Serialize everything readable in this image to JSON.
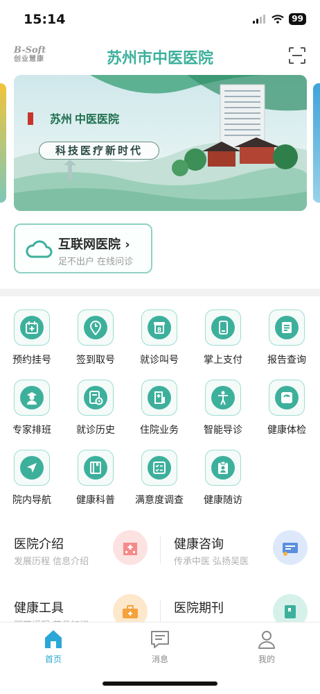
{
  "status_bar": {
    "time": "15:14",
    "battery": "99"
  },
  "header": {
    "logo_top": "B-Soft",
    "logo_bottom": "创业慧康",
    "title": "苏州市中医医院"
  },
  "banner": {
    "brand_big": "苏州",
    "brand_small": "中医医院",
    "slogan": "科技医疗新时代"
  },
  "internet_hospital": {
    "title": "互联网医院 ›",
    "subtitle": "足不出户 在线问诊"
  },
  "grid": [
    {
      "label": "预约挂号",
      "icon": "calendar-add-icon"
    },
    {
      "label": "签到取号",
      "icon": "location-clock-icon"
    },
    {
      "label": "就诊叫号",
      "icon": "queue-ticket-icon"
    },
    {
      "label": "掌上支付",
      "icon": "phone-pay-icon"
    },
    {
      "label": "报告查询",
      "icon": "report-icon"
    },
    {
      "label": "专家排班",
      "icon": "doctor-icon"
    },
    {
      "label": "就诊历史",
      "icon": "history-icon"
    },
    {
      "label": "住院业务",
      "icon": "hospital-bed-icon"
    },
    {
      "label": "智能导诊",
      "icon": "body-guide-icon"
    },
    {
      "label": "健康体检",
      "icon": "scale-icon"
    },
    {
      "label": "院内导航",
      "icon": "navigation-icon"
    },
    {
      "label": "健康科普",
      "icon": "book-icon"
    },
    {
      "label": "满意度调查",
      "icon": "checklist-icon"
    },
    {
      "label": "健康随访",
      "icon": "clipboard-user-icon"
    }
  ],
  "info_cards": [
    {
      "title": "医院介绍",
      "subtitle": "发展历程 信息介绍",
      "icon": "hospital-building-icon",
      "color": "#f58a8a"
    },
    {
      "title": "健康咨询",
      "subtitle": "传承中医 弘扬吴医",
      "icon": "consult-card-icon",
      "color": "#5a8fe0"
    },
    {
      "title": "健康工具",
      "subtitle": "服药提醒 药品知识",
      "icon": "toolbox-icon",
      "color": "#f5a23c"
    },
    {
      "title": "医院期刊",
      "subtitle": "",
      "icon": "journal-icon",
      "color": "#3db09c"
    }
  ],
  "tabbar": [
    {
      "label": "首页",
      "icon": "home-icon",
      "active": true
    },
    {
      "label": "消息",
      "icon": "message-icon",
      "active": false
    },
    {
      "label": "我的",
      "icon": "user-icon",
      "active": false
    }
  ],
  "colors": {
    "accent": "#3db09c",
    "tab_active": "#2aa7d6",
    "tab_inactive": "#888888"
  }
}
